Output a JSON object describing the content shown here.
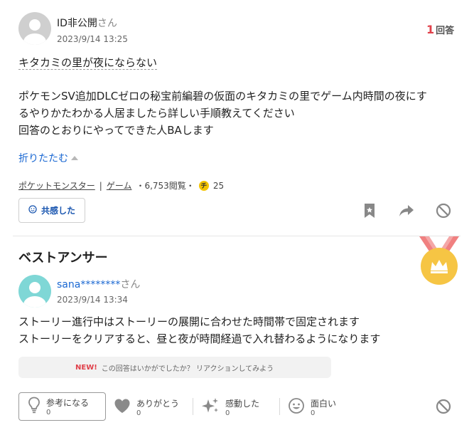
{
  "question": {
    "user": {
      "name": "ID非公開",
      "honorific": "さん"
    },
    "date": "2023/9/14 13:25",
    "answers": {
      "count": "1",
      "label": "回答"
    },
    "title": "キタカミの里が夜にならない",
    "body_line1": "ポケモンSV追加DLCゼロの秘宝前編碧の仮面のキタカミの里でゲーム内時間の夜にす",
    "body_line2": "るやりかたわかる人居ましたら詳しい手順教えてください",
    "body_line3": "回答のとおりにやってできた人BAします",
    "fold_label": "折りたたむ",
    "category1": "ポケットモンスター",
    "separator": "|",
    "category2": "ゲーム",
    "views": "・6,753閲覧・",
    "coin_symbol": "チ",
    "coin_amount": "25",
    "empathy_label": "共感した"
  },
  "best_answer": {
    "heading": "ベストアンサー",
    "user": {
      "name": "sana********",
      "honorific": "さん"
    },
    "date": "2023/9/14 13:34",
    "body_line1": "ストーリー進行中はストーリーの展開に合わせた時間帯で固定されます",
    "body_line2": "ストーリーをクリアすると、昼と夜が時間経過で入れ替わるようになります",
    "reaction_prompt": {
      "new_badge": "NEW!",
      "text": "この回答はいかがでしたか？ リアクションしてみよう"
    },
    "reactions": [
      {
        "label": "参考になる",
        "count": "0",
        "icon": "lightbulb-icon"
      },
      {
        "label": "ありがとう",
        "count": "0",
        "icon": "heart-icon"
      },
      {
        "label": "感動した",
        "count": "0",
        "icon": "sparkle-icon"
      },
      {
        "label": "面白い",
        "count": "0",
        "icon": "smile-icon"
      }
    ]
  },
  "colors": {
    "link": "#1967d2",
    "accent_red": "#e0404a",
    "medal_gold": "#f6c544",
    "ribbon": "#f08080",
    "avatar_teal": "#7fd7d6"
  }
}
